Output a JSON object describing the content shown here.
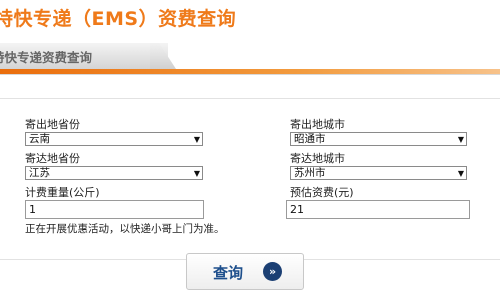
{
  "header": {
    "title": "特快专递（EMS）资费查询"
  },
  "tab": {
    "label": "特快专递资费查询"
  },
  "colors": {
    "accent": "#ef7a1a",
    "button_text": "#1e4f8c"
  },
  "form": {
    "origin_province_label": "寄出地省份",
    "origin_province_value": "云南",
    "origin_city_label": "寄出地城市",
    "origin_city_value": "昭通市",
    "dest_province_label": "寄达地省份",
    "dest_province_value": "江苏",
    "dest_city_label": "寄达地城市",
    "dest_city_value": "苏州市",
    "weight_label": "计费重量(公斤)",
    "weight_value": "1",
    "fee_label": "预估资费(元)",
    "fee_value": "21",
    "note": "正在开展优惠活动，以快递小哥上门为准。"
  },
  "query_button": {
    "label": "查询",
    "icon": "double-chevron-right-icon"
  }
}
